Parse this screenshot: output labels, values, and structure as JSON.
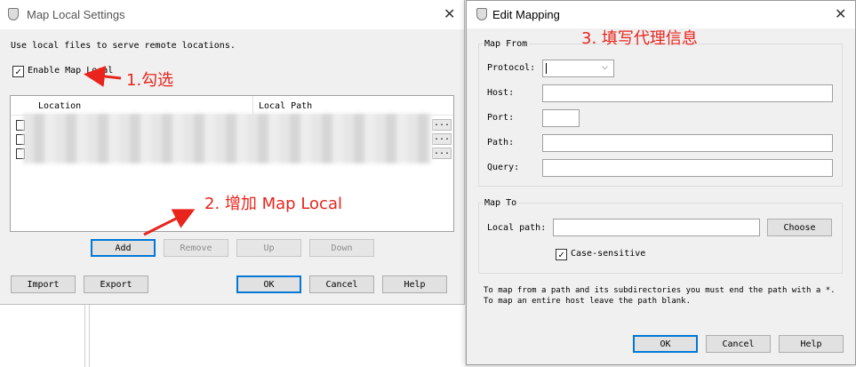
{
  "map_local": {
    "title": "Map Local Settings",
    "description": "Use local files to serve remote locations.",
    "enable_label": "Enable Map Local",
    "enable_checked": true,
    "columns": [
      "Location",
      "Local Path"
    ],
    "row_action": "...",
    "buttons": {
      "add": "Add",
      "remove": "Remove",
      "up": "Up",
      "down": "Down"
    },
    "footer": {
      "import": "Import",
      "export": "Export",
      "ok": "OK",
      "cancel": "Cancel",
      "help": "Help"
    }
  },
  "edit_mapping": {
    "title": "Edit Mapping",
    "map_from": {
      "legend": "Map From",
      "protocol_label": "Protocol:",
      "host_label": "Host:",
      "port_label": "Port:",
      "path_label": "Path:",
      "query_label": "Query:"
    },
    "map_to": {
      "legend": "Map To",
      "local_path_label": "Local path:",
      "choose": "Choose",
      "case_label": "Case-sensitive",
      "case_checked": true
    },
    "hint": "To map from a path and its subdirectories you must end the path with a *. To map an entire host leave the path blank.",
    "footer": {
      "ok": "OK",
      "cancel": "Cancel",
      "help": "Help"
    }
  },
  "annotations": {
    "step1": "1.勾选",
    "step2": "2. 增加 Map Local",
    "step3": "3. 填写代理信息"
  },
  "colors": {
    "annotation": "#e8241c",
    "focus": "#0078d7"
  }
}
